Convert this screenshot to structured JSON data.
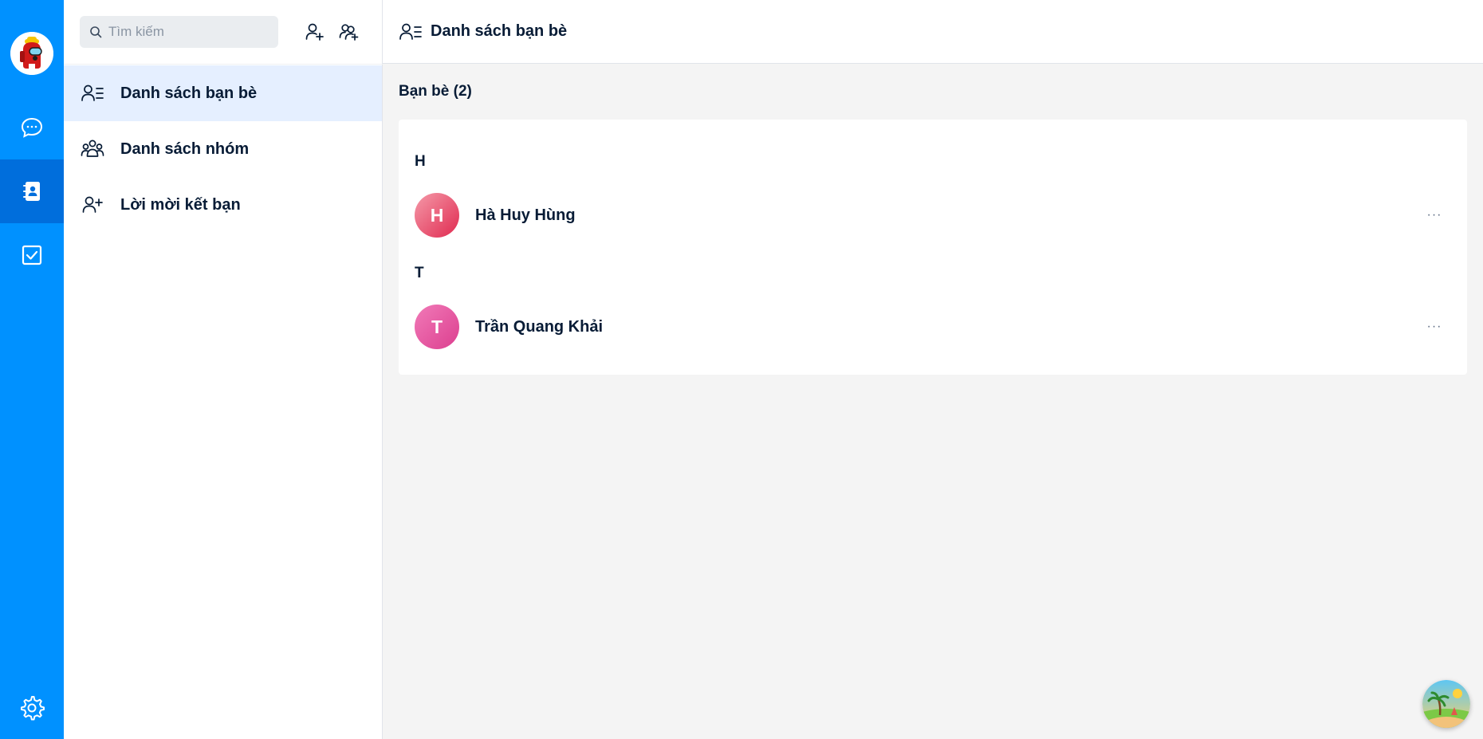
{
  "rail": {
    "avatar_icon": "among-us-avatar",
    "items": [
      {
        "icon": "chat-icon",
        "active": false
      },
      {
        "icon": "contacts-icon",
        "active": true
      },
      {
        "icon": "todo-checkbox-icon",
        "active": false
      },
      {
        "icon": "gear-icon",
        "active": false
      }
    ],
    "color": "#0091ff",
    "active_color": "#006edc"
  },
  "search": {
    "placeholder": "Tìm kiếm",
    "value": ""
  },
  "toolbar": {
    "add_friend_icon": "add-user-icon",
    "create_group_icon": "add-group-icon"
  },
  "menu": {
    "items": [
      {
        "label": "Danh sách bạn bè",
        "icon": "friend-list-icon",
        "active": true
      },
      {
        "label": "Danh sách nhóm",
        "icon": "group-icon",
        "active": false
      },
      {
        "label": "Lời mời kết bạn",
        "icon": "add-user-icon",
        "active": false
      }
    ]
  },
  "header": {
    "title": "Danh sách bạn bè"
  },
  "friends": {
    "count_label": "Bạn bè (2)",
    "groups": [
      {
        "letter": "H",
        "contacts": [
          {
            "initial": "H",
            "name": "Hà Huy Hùng",
            "more": "···"
          }
        ]
      },
      {
        "letter": "T",
        "contacts": [
          {
            "initial": "T",
            "name": "Trần Quang Khải",
            "more": "···"
          }
        ]
      }
    ]
  },
  "accent_colors": {
    "active_menu_bg": "#e5efff",
    "avatar_h": "#e02a50",
    "avatar_t": "#dc3f8f"
  }
}
